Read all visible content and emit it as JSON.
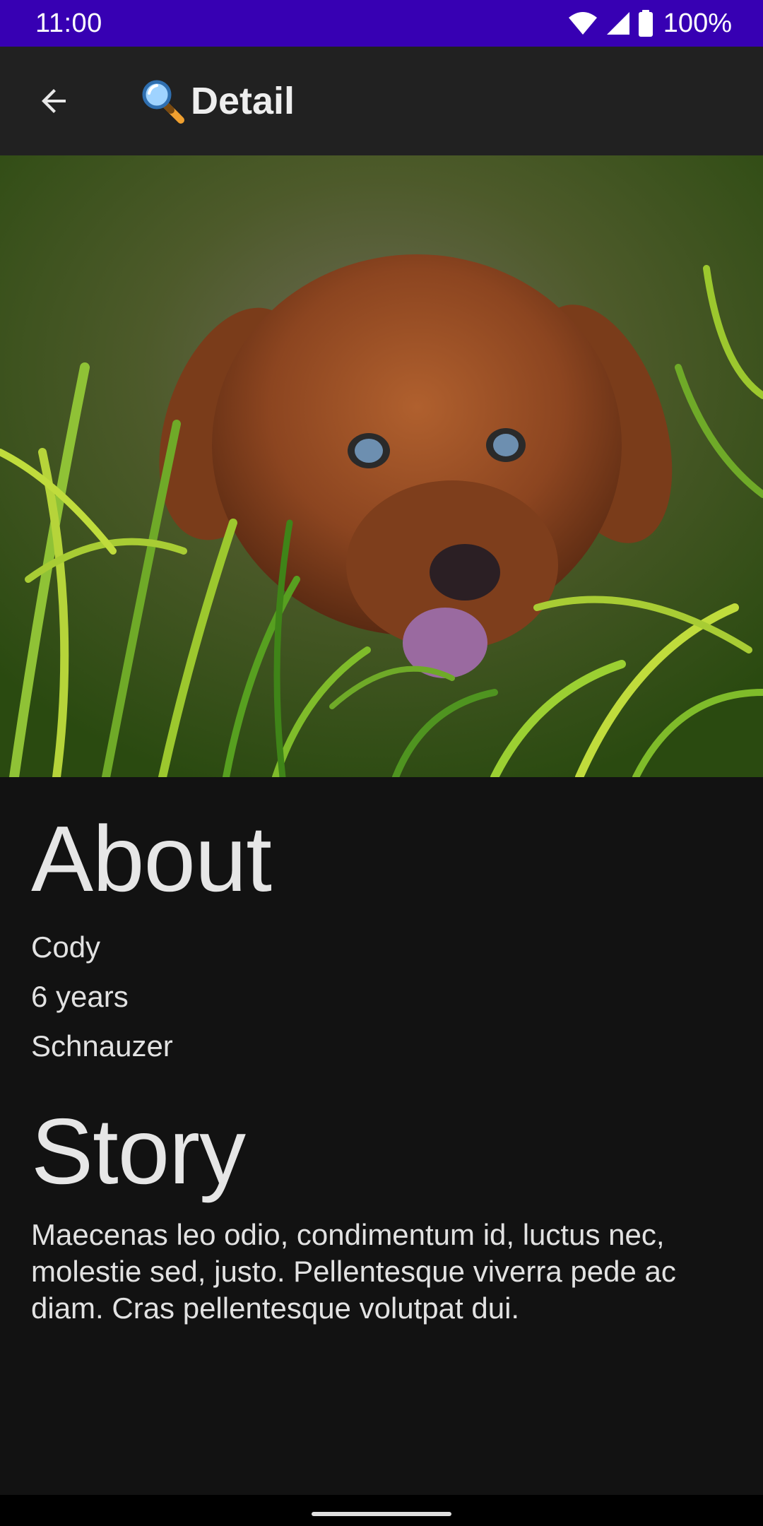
{
  "status_bar": {
    "time": "11:00",
    "battery": "100%",
    "icons": [
      "wifi-icon",
      "signal-icon",
      "battery-icon"
    ],
    "color": "#3700b3"
  },
  "app_bar": {
    "back_icon": "arrow-back-icon",
    "title_icon": "magnifying-glass-icon",
    "title": "Detail",
    "background": "#212121"
  },
  "hero": {
    "subject": "puppy-photo"
  },
  "about": {
    "title": "About",
    "name": "Cody",
    "age": "6 years",
    "breed": "Schnauzer"
  },
  "story": {
    "title": "Story",
    "text": "Maecenas leo odio, condimentum id, luctus nec, molestie sed, justo. Pellentesque viverra pede ac diam. Cras pellentesque volutpat dui."
  },
  "colors": {
    "background": "#121212",
    "text": "#e6e6e6"
  }
}
